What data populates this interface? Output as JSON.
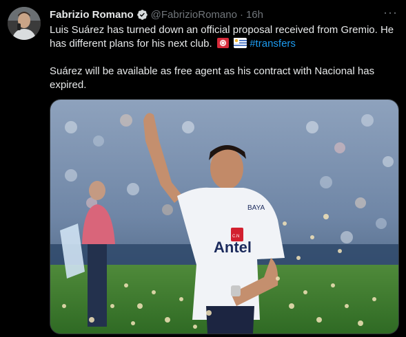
{
  "tweet": {
    "author_name": "Fabrizio Romano",
    "handle": "@FabrizioRomano",
    "separator": "·",
    "time": "16h",
    "more_label": "···",
    "line1_before": "Luis Suárez has turned down an official proposal received from Gremio. He has different plans for his next club.",
    "hashtag": "#transfers",
    "paragraph2": "Suárez will be available as free agent as his contract with Nacional has expired."
  },
  "media": {
    "shirt_sponsor": "Antel",
    "shirt_brand": "BAYA",
    "crest_text": "C.N"
  },
  "colors": {
    "background": "#000000",
    "text": "#e7e9ea",
    "muted": "#71767b",
    "link": "#1d9bf0",
    "verified_badge": "#d7dbdc"
  },
  "icons": [
    "verified-badge-icon",
    "more-options-icon",
    "flag-icon",
    "uruguay-flag-icon"
  ]
}
